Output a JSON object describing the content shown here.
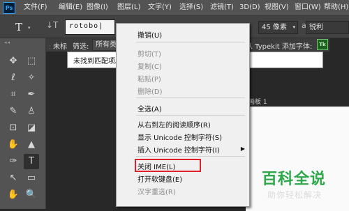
{
  "app": {
    "logo": "Ps"
  },
  "menubar": {
    "items": [
      "文件(F)",
      "编辑(E)",
      "图像(I)",
      "图层(L)",
      "文字(Y)",
      "选择(S)",
      "滤镜(T)",
      "3D(D)",
      "视图(V)",
      "窗口(W)",
      "帮助(H)"
    ]
  },
  "options": {
    "tool_glyph": "T",
    "caret": "▾",
    "orient_glyph": "↓T",
    "font_input": "rotobo|",
    "size_value": "45 像素",
    "aa_glyph": "aa",
    "sharpness_value": "锐利"
  },
  "font_panel": {
    "left_label": "未标",
    "filter_label": "筛选:",
    "class_value": "所有类",
    "typekit_label": "从 Typekit 添加字体:",
    "typekit_badge": "Tk",
    "no_match": "未找到匹配项。"
  },
  "canvas": {
    "doc_tab": "未标",
    "artboard_label": "画板 1"
  },
  "toolbar": {
    "grip": "◂◂",
    "tools": [
      "✥",
      "⬚",
      "ℓ",
      "✧",
      "⌗",
      "✒",
      "✎",
      "♙",
      "⊡",
      "◪",
      "✋",
      "▲",
      "✑",
      "T",
      "↖",
      "▭",
      "✋",
      "🔍",
      "⋯"
    ]
  },
  "context_menu": {
    "items": [
      {
        "label": "撤销(U)",
        "enabled": true
      },
      {
        "label": "剪切(T)",
        "enabled": false
      },
      {
        "label": "复制(C)",
        "enabled": false
      },
      {
        "label": "粘贴(P)",
        "enabled": false
      },
      {
        "label": "删除(D)",
        "enabled": false
      },
      {
        "label": "全选(A)",
        "enabled": true
      },
      {
        "label": "从右到左的阅读顺序(R)",
        "enabled": true
      },
      {
        "label": "显示 Unicode 控制字符(S)",
        "enabled": true
      },
      {
        "label": "插入 Unicode 控制字符(I)",
        "enabled": true
      },
      {
        "label": "关闭 IME(L)",
        "enabled": true
      },
      {
        "label": "打开软键盘(E)",
        "enabled": true
      },
      {
        "label": "汉字重选(R)",
        "enabled": false
      }
    ],
    "submenu_arrow": "▶",
    "highlight_color": "#e0202a"
  },
  "watermark": {
    "title": "百科全说",
    "subtitle": "助你轻松解决"
  }
}
